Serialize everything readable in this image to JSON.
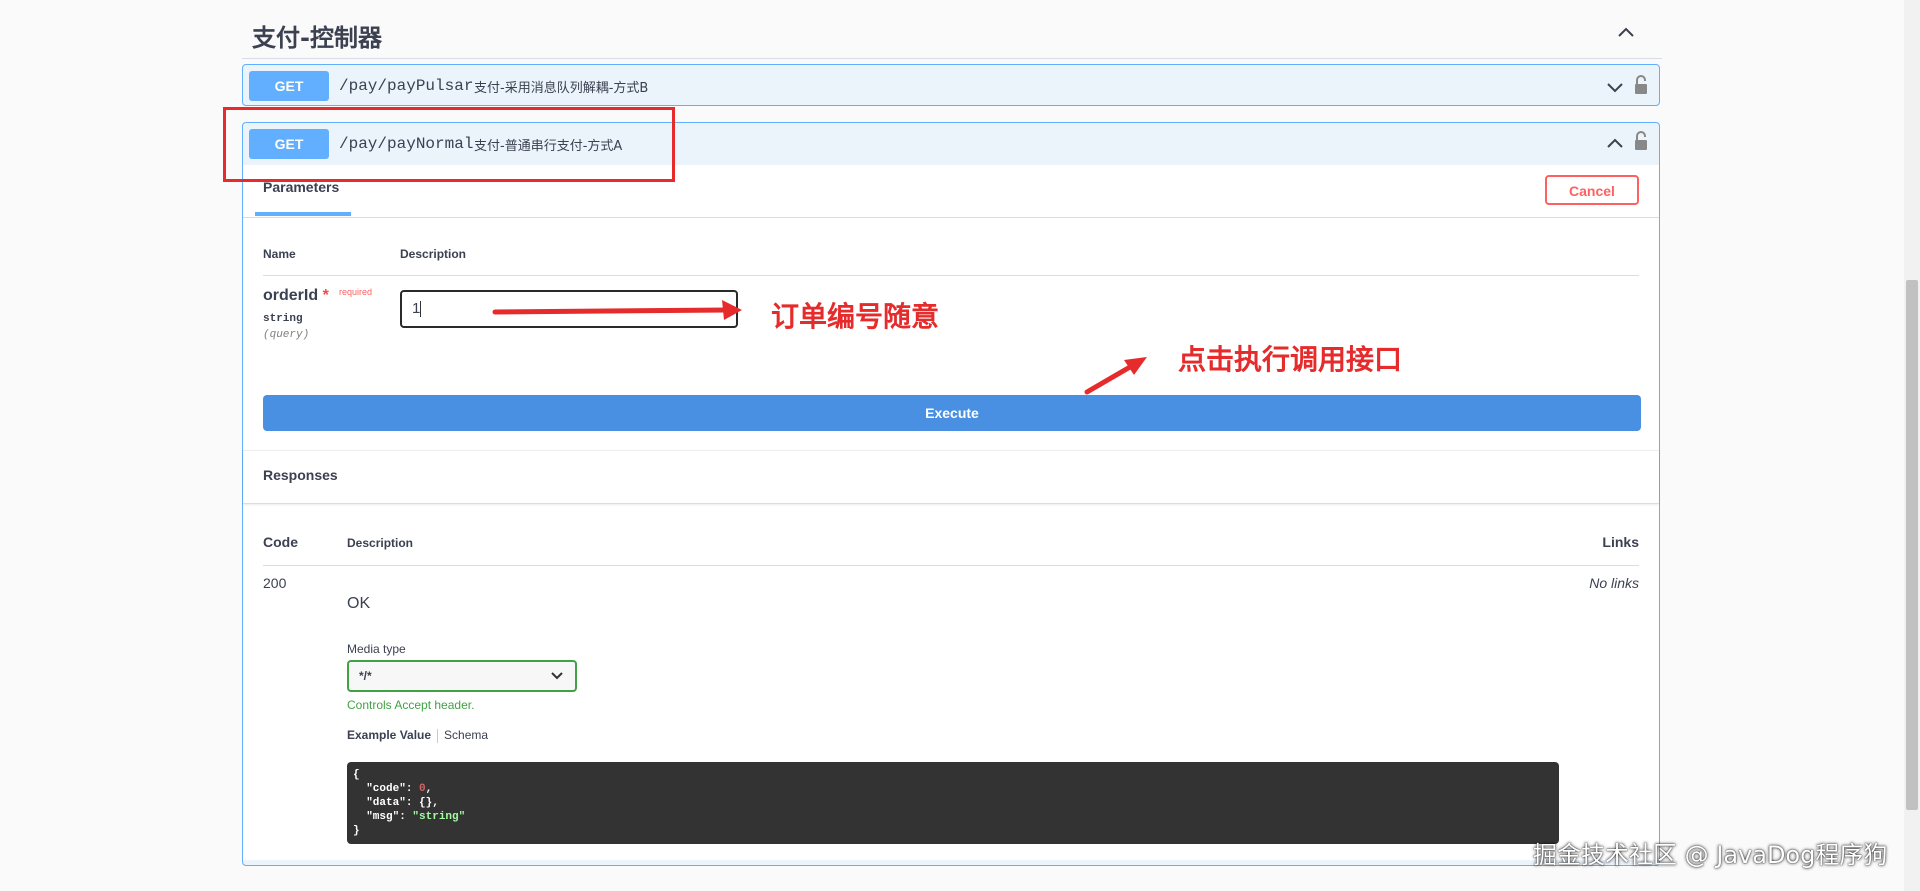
{
  "section": {
    "title": "支付-控制器"
  },
  "operations": [
    {
      "method": "GET",
      "path": "/pay/payPulsar",
      "description": "支付-采用消息队列解耦-方式B"
    },
    {
      "method": "GET",
      "path": "/pay/payNormal",
      "description": "支付-普通串行支付-方式A"
    }
  ],
  "tabs": {
    "parameters": "Parameters",
    "cancel": "Cancel"
  },
  "param_table": {
    "name_header": "Name",
    "description_header": "Description",
    "param": {
      "name": "orderId",
      "required_star": "*",
      "required_label": "required",
      "type": "string",
      "in": "(query)",
      "value": "1"
    }
  },
  "execute_label": "Execute",
  "responses": {
    "title": "Responses",
    "code_header": "Code",
    "description_header": "Description",
    "links_header": "Links",
    "code": "200",
    "ok": "OK",
    "no_links": "No links",
    "media_type_label": "Media type",
    "media_type_value": "*/*",
    "media_hint": "Controls Accept header.",
    "example_value_tab": "Example Value",
    "schema_tab": "Schema",
    "example": {
      "open": "{",
      "code_key": "\"code\"",
      "code_val": "0",
      "data_key": "\"data\"",
      "data_val": "{}",
      "msg_key": "\"msg\"",
      "msg_val": "\"string\"",
      "close": "}"
    }
  },
  "annotations": {
    "order_hint": "订单编号随意",
    "execute_hint": "点击执行调用接口",
    "color": "#e52b2b"
  },
  "watermark": "掘金技术社区 @ JavaDog程序狗",
  "colors": {
    "get": "#61affe",
    "execute": "#4990e2",
    "cancel": "#ff6060",
    "media_ok": "#41a244"
  }
}
